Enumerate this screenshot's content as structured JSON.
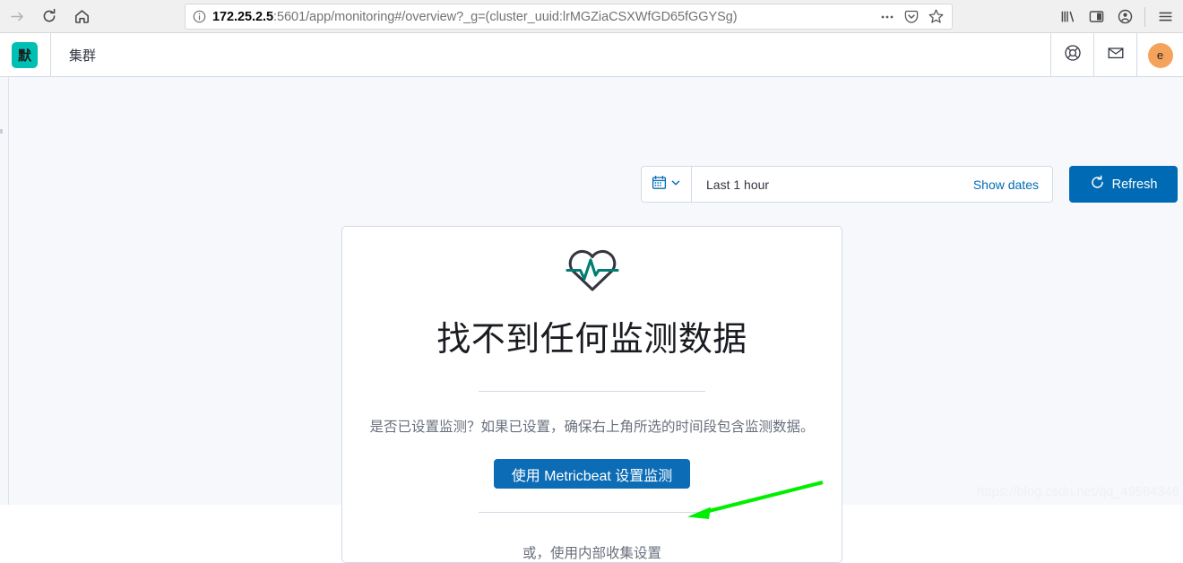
{
  "browser": {
    "nav": {
      "forward_icon": "arrow-right-icon",
      "reload_icon": "reload-icon",
      "home_icon": "home-icon"
    },
    "address_bar": {
      "info_icon": "page-info-icon",
      "host": "172.25.2.5",
      "path": ":5601/app/monitoring#/overview?_g=(cluster_uuid:lrMGZiaCSXWfGD65fGGYSg)",
      "full_url": "172.25.2.5:5601/app/monitoring#/overview?_g=(cluster_uuid:lrMGZiaCSXWfGD65fGGYSg)",
      "page_actions_icon": "ellipsis-icon",
      "pocket_icon": "pocket-icon",
      "bookmark_icon": "star-icon"
    },
    "toolbar_right": {
      "library_icon": "library-icon",
      "sidebar_icon": "sidebar-icon",
      "account_icon": "account-icon",
      "menu_icon": "hamburger-menu-icon"
    }
  },
  "kibana_header": {
    "logo_label": "默",
    "logo_color": "#00bfb3",
    "breadcrumb": "集群",
    "help_icon": "lifebuoy-help-icon",
    "news_icon": "mail-news-icon",
    "avatar_initial": "e",
    "avatar_color": "#f5a35c"
  },
  "toolbar": {
    "quick_select_icon": "calendar-icon",
    "quick_select_chevron": "chevron-down-icon",
    "time_range_value": "Last 1 hour",
    "show_dates_label": "Show dates",
    "refresh_icon": "refresh-icon",
    "refresh_label": "Refresh",
    "refresh_color": "#006bb4"
  },
  "empty_state": {
    "icon": "heartbeat-monitoring-icon",
    "icon_accent_color": "#017d73",
    "title": "找不到任何监测数据",
    "description": "是否已设置监测？如果已设置，确保右上角所选的时间段包含监测数据。",
    "primary_button_label": "使用 Metricbeat 设置监测",
    "primary_button_color": "#0c6cb5",
    "secondary_link_label": "或，使用内部收集设置"
  },
  "annotation": {
    "arrow_color": "#00ef00",
    "arrow_name": "green-pointer-arrow"
  },
  "watermark": {
    "text": "https://blog.csdn.net/qq_49564346"
  }
}
